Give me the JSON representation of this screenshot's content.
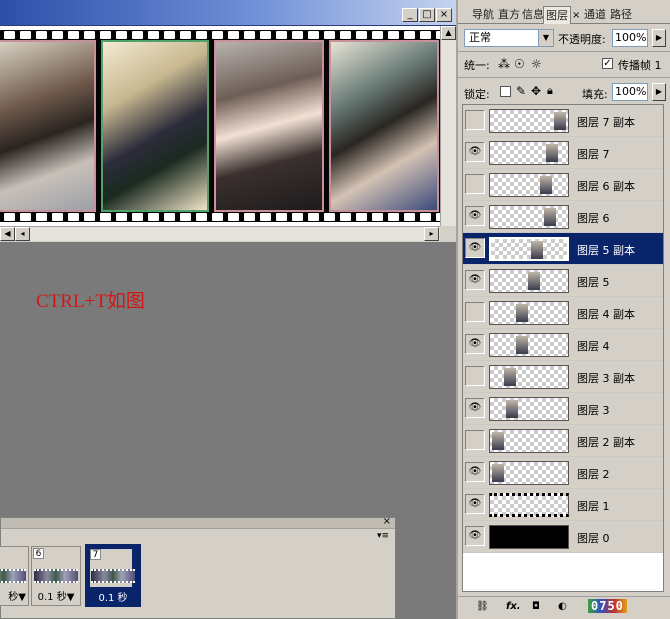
{
  "document": {
    "window_buttons": [
      "_",
      "□",
      "×"
    ],
    "annotation": "CTRL+T如图"
  },
  "layers_panel": {
    "tabs": [
      "导航",
      "直方",
      "信息",
      "图层",
      "通道",
      "路径"
    ],
    "active_tab": "图层",
    "blend_mode": "正常",
    "opacity_label": "不透明度:",
    "opacity_value": "100%",
    "unify_label": "统一:",
    "propagate_label": "传播帧 1",
    "lock_label": "锁定:",
    "fill_label": "填充:",
    "fill_value": "100%",
    "layers": [
      {
        "name": "图层 7 副本",
        "visible": false,
        "selected": false
      },
      {
        "name": "图层 7",
        "visible": true,
        "selected": false
      },
      {
        "name": "图层 6 副本",
        "visible": false,
        "selected": false
      },
      {
        "name": "图层 6",
        "visible": true,
        "selected": false
      },
      {
        "name": "图层 5 副本",
        "visible": true,
        "selected": true
      },
      {
        "name": "图层 5",
        "visible": true,
        "selected": false
      },
      {
        "name": "图层 4 副本",
        "visible": false,
        "selected": false
      },
      {
        "name": "图层 4",
        "visible": true,
        "selected": false
      },
      {
        "name": "图层 3 副本",
        "visible": false,
        "selected": false
      },
      {
        "name": "图层 3",
        "visible": true,
        "selected": false
      },
      {
        "name": "图层 2 副本",
        "visible": false,
        "selected": false
      },
      {
        "name": "图层 2",
        "visible": true,
        "selected": false
      },
      {
        "name": "图层 1",
        "visible": true,
        "selected": false
      },
      {
        "name": "图层 0",
        "visible": true,
        "selected": false
      }
    ],
    "watermark": "0750"
  },
  "animation_panel": {
    "frames": [
      {
        "number": "",
        "delay": "秒▼",
        "selected": false
      },
      {
        "number": "6",
        "delay": "0.1 秒▼",
        "selected": false
      },
      {
        "number": "7",
        "delay": "0.1 秒",
        "selected": true
      }
    ]
  },
  "colors": {
    "selection": "#0a246a",
    "annotation": "#d01818",
    "workspace": "#7a7a7a"
  }
}
